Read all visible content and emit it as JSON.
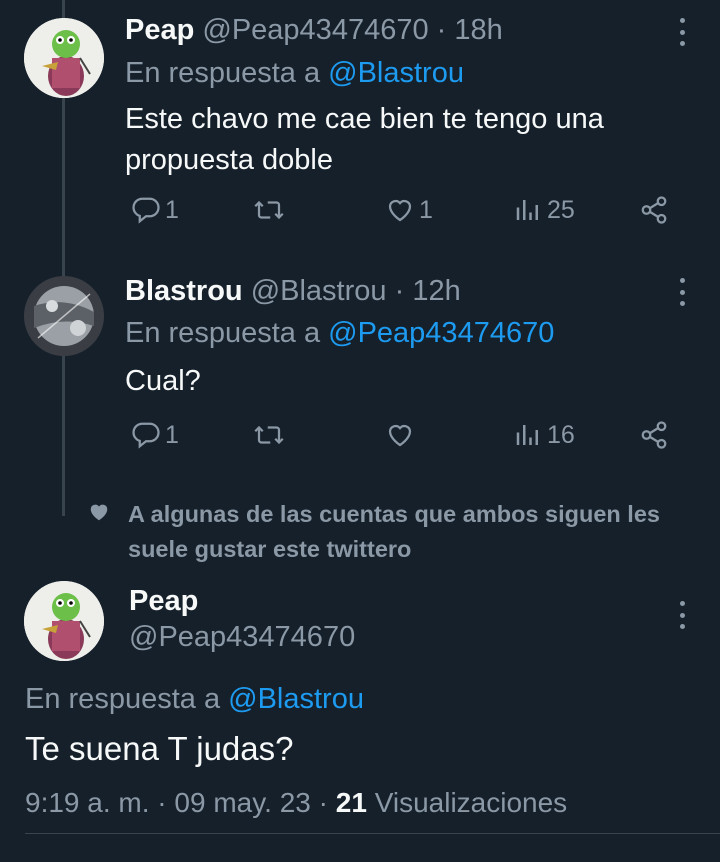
{
  "tweets": [
    {
      "name": "Peap",
      "handle": "@Peap43474670",
      "dot": "·",
      "time": "18h",
      "reply_prefix": "En respuesta a ",
      "reply_to": "@Blastrou",
      "text_line1": "Este chavo me cae bien te tengo una",
      "text_line2": "propuesta doble",
      "replies": "1",
      "retweets": "",
      "likes": "1",
      "views": "25",
      "avatar_icon": "green-character-avatar"
    },
    {
      "name": "Blastrou",
      "handle": "@Blastrou",
      "dot": "·",
      "time": "12h",
      "reply_prefix": "En respuesta a ",
      "reply_to": "@Peap43474670",
      "text_line1": "Cual?",
      "replies": "1",
      "retweets": "",
      "likes": "",
      "views": "16",
      "avatar_icon": "gray-space-avatar"
    }
  ],
  "social_context": "A algunas de las cuentas que ambos siguen les suele gustar este twittero",
  "main_tweet": {
    "name": "Peap",
    "handle": "@Peap43474670",
    "reply_prefix": "En respuesta a ",
    "reply_to": "@Blastrou",
    "text": "Te suena T judas?",
    "time": "9:19 a. m.",
    "date": "09 may. 23",
    "views_count": "21",
    "views_label": "Visualizaciones",
    "sep": "·"
  },
  "colors": {
    "background": "#15202b",
    "text": "#f7f9f9",
    "muted": "#8b98a5",
    "link": "#1d9bf0"
  }
}
